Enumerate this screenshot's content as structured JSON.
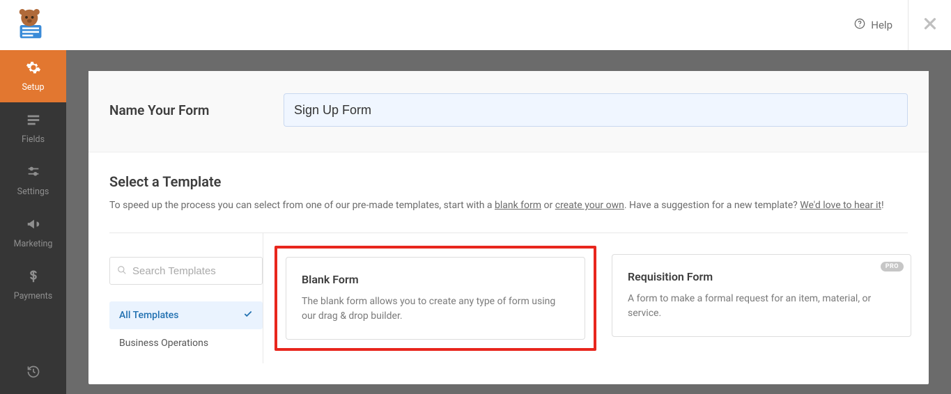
{
  "top": {
    "help_label": "Help"
  },
  "sidebar": {
    "items": [
      {
        "label": "Setup"
      },
      {
        "label": "Fields"
      },
      {
        "label": "Settings"
      },
      {
        "label": "Marketing"
      },
      {
        "label": "Payments"
      }
    ]
  },
  "name_section": {
    "label": "Name Your Form",
    "value": "Sign Up Form"
  },
  "template_section": {
    "title": "Select a Template",
    "desc_pre": "To speed up the process you can select from one of our pre-made templates, start with a ",
    "blank_link": "blank form",
    "desc_or": " or ",
    "create_link": "create your own",
    "desc_post": ". Have a suggestion for a new template? ",
    "feedback_link": "We'd love to hear it",
    "desc_end": "!",
    "search_placeholder": "Search Templates",
    "categories": [
      {
        "label": "All Templates",
        "active": true
      },
      {
        "label": "Business Operations",
        "active": false
      }
    ],
    "cards": [
      {
        "title": "Blank Form",
        "desc": "The blank form allows you to create any type of form using our drag & drop builder.",
        "highlight": true,
        "pro": false
      },
      {
        "title": "Requisition Form",
        "desc": "A form to make a formal request for an item, material, or service.",
        "highlight": false,
        "pro": true,
        "pro_label": "PRO"
      }
    ]
  }
}
